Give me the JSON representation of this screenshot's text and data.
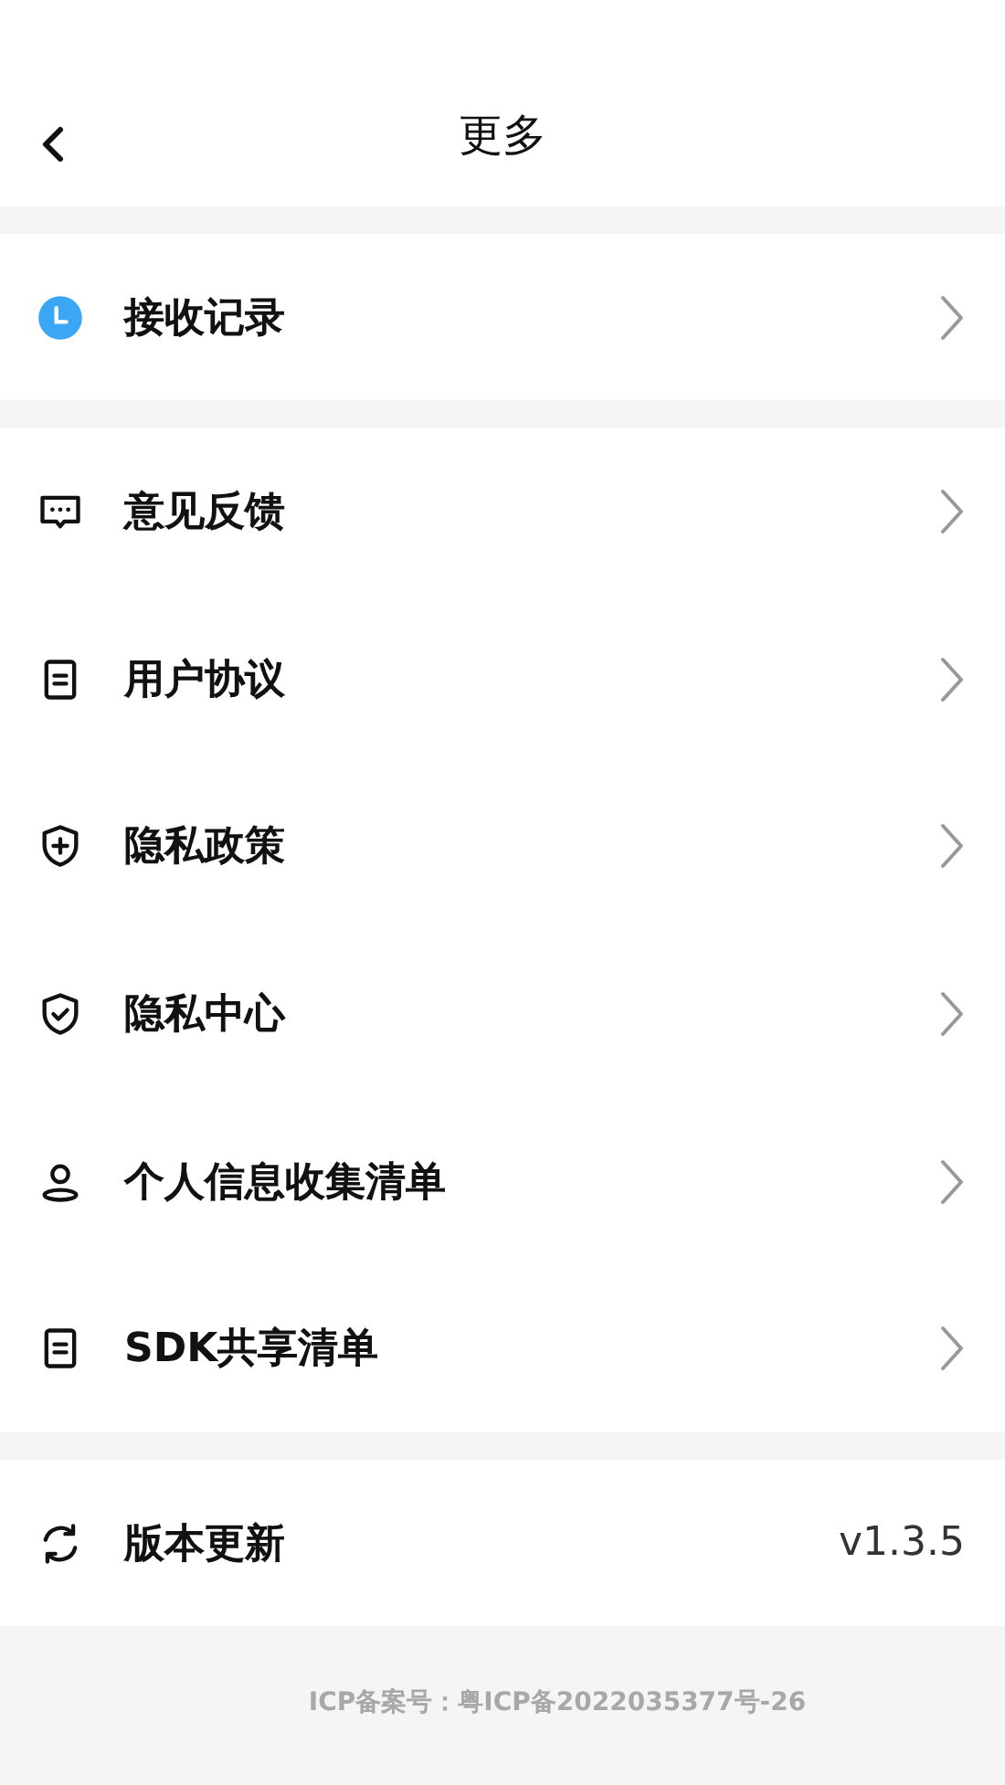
{
  "header": {
    "title": "更多"
  },
  "groups": [
    {
      "items": [
        {
          "label": "接收记录",
          "kind": "link"
        }
      ]
    },
    {
      "items": [
        {
          "label": "意见反馈",
          "kind": "link"
        },
        {
          "label": "用户协议",
          "kind": "link"
        },
        {
          "label": "隐私政策",
          "kind": "link"
        },
        {
          "label": "隐私中心",
          "kind": "link"
        },
        {
          "label": "个人信息收集清单",
          "kind": "link"
        },
        {
          "label": "SDK共享清单",
          "kind": "link"
        }
      ]
    },
    {
      "items": [
        {
          "label": "版本更新",
          "kind": "info",
          "value": "v1.3.5"
        }
      ]
    }
  ],
  "footer": {
    "text": "ICP备案号：粤ICP备2022035377号-26"
  }
}
